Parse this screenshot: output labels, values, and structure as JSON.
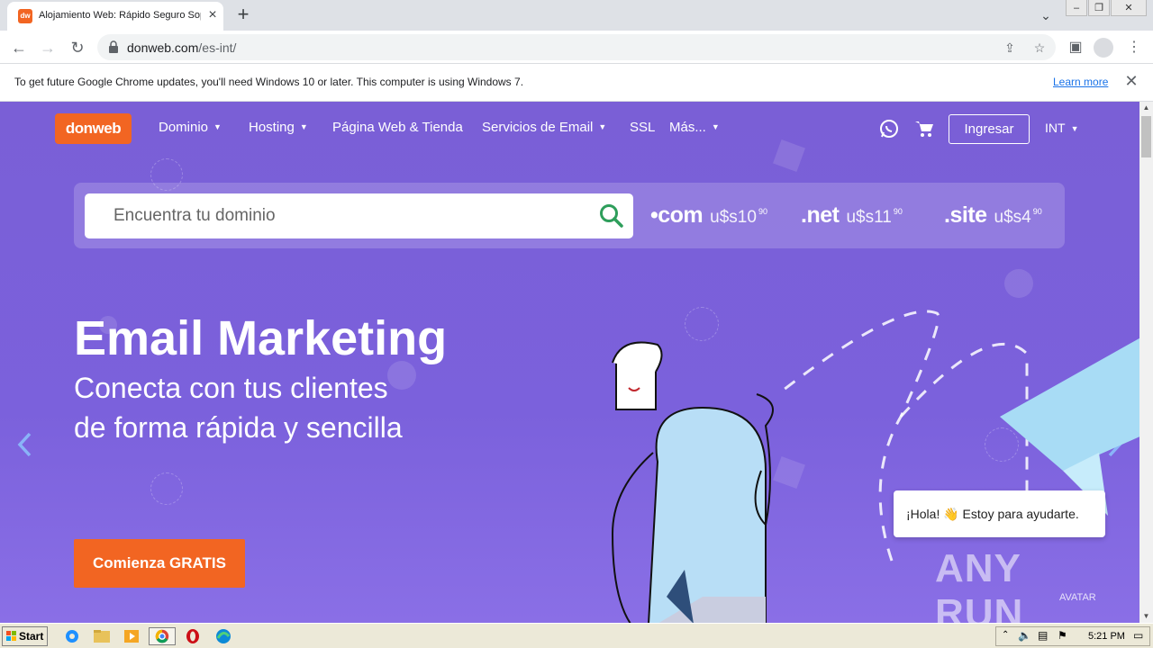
{
  "browser": {
    "tab_title": "Alojamiento Web: Rápido Seguro Sop",
    "tab_favicon_text": "dw",
    "url_domain": "donweb.com",
    "url_path": "/es-int/",
    "infobar_text": "To get future Google Chrome updates, you'll need Windows 10 or later. This computer is using Windows 7.",
    "infobar_link": "Learn more"
  },
  "site": {
    "logo": "donweb",
    "nav": [
      "Dominio",
      "Hosting",
      "Página Web & Tienda",
      "Servicios de Email",
      "SSL",
      "Más..."
    ],
    "login": "Ingresar",
    "lang": "INT",
    "search_placeholder": "Encuentra tu dominio",
    "tlds": [
      {
        "name": "•com",
        "price": "u$s10",
        "cents": "90"
      },
      {
        "name": ".net",
        "price": "u$s11",
        "cents": "90"
      },
      {
        "name": ".site",
        "price": "u$s4",
        "cents": "90"
      }
    ],
    "hero_title": "Email Marketing",
    "hero_line1": "Conecta con tus clientes",
    "hero_line2": "de forma rápida y sencilla",
    "cta": "Comienza GRATIS",
    "chat_text": "¡Hola! 👋 Estoy para ayudarte."
  },
  "watermark": {
    "text": "ANY RUN",
    "sub": "AVATAR"
  },
  "taskbar": {
    "start": "Start",
    "clock": "5:21 PM"
  },
  "colors": {
    "brand_orange": "#f26522",
    "hero_purple": "#7a5fd6",
    "search_green": "#2e9e5b"
  }
}
